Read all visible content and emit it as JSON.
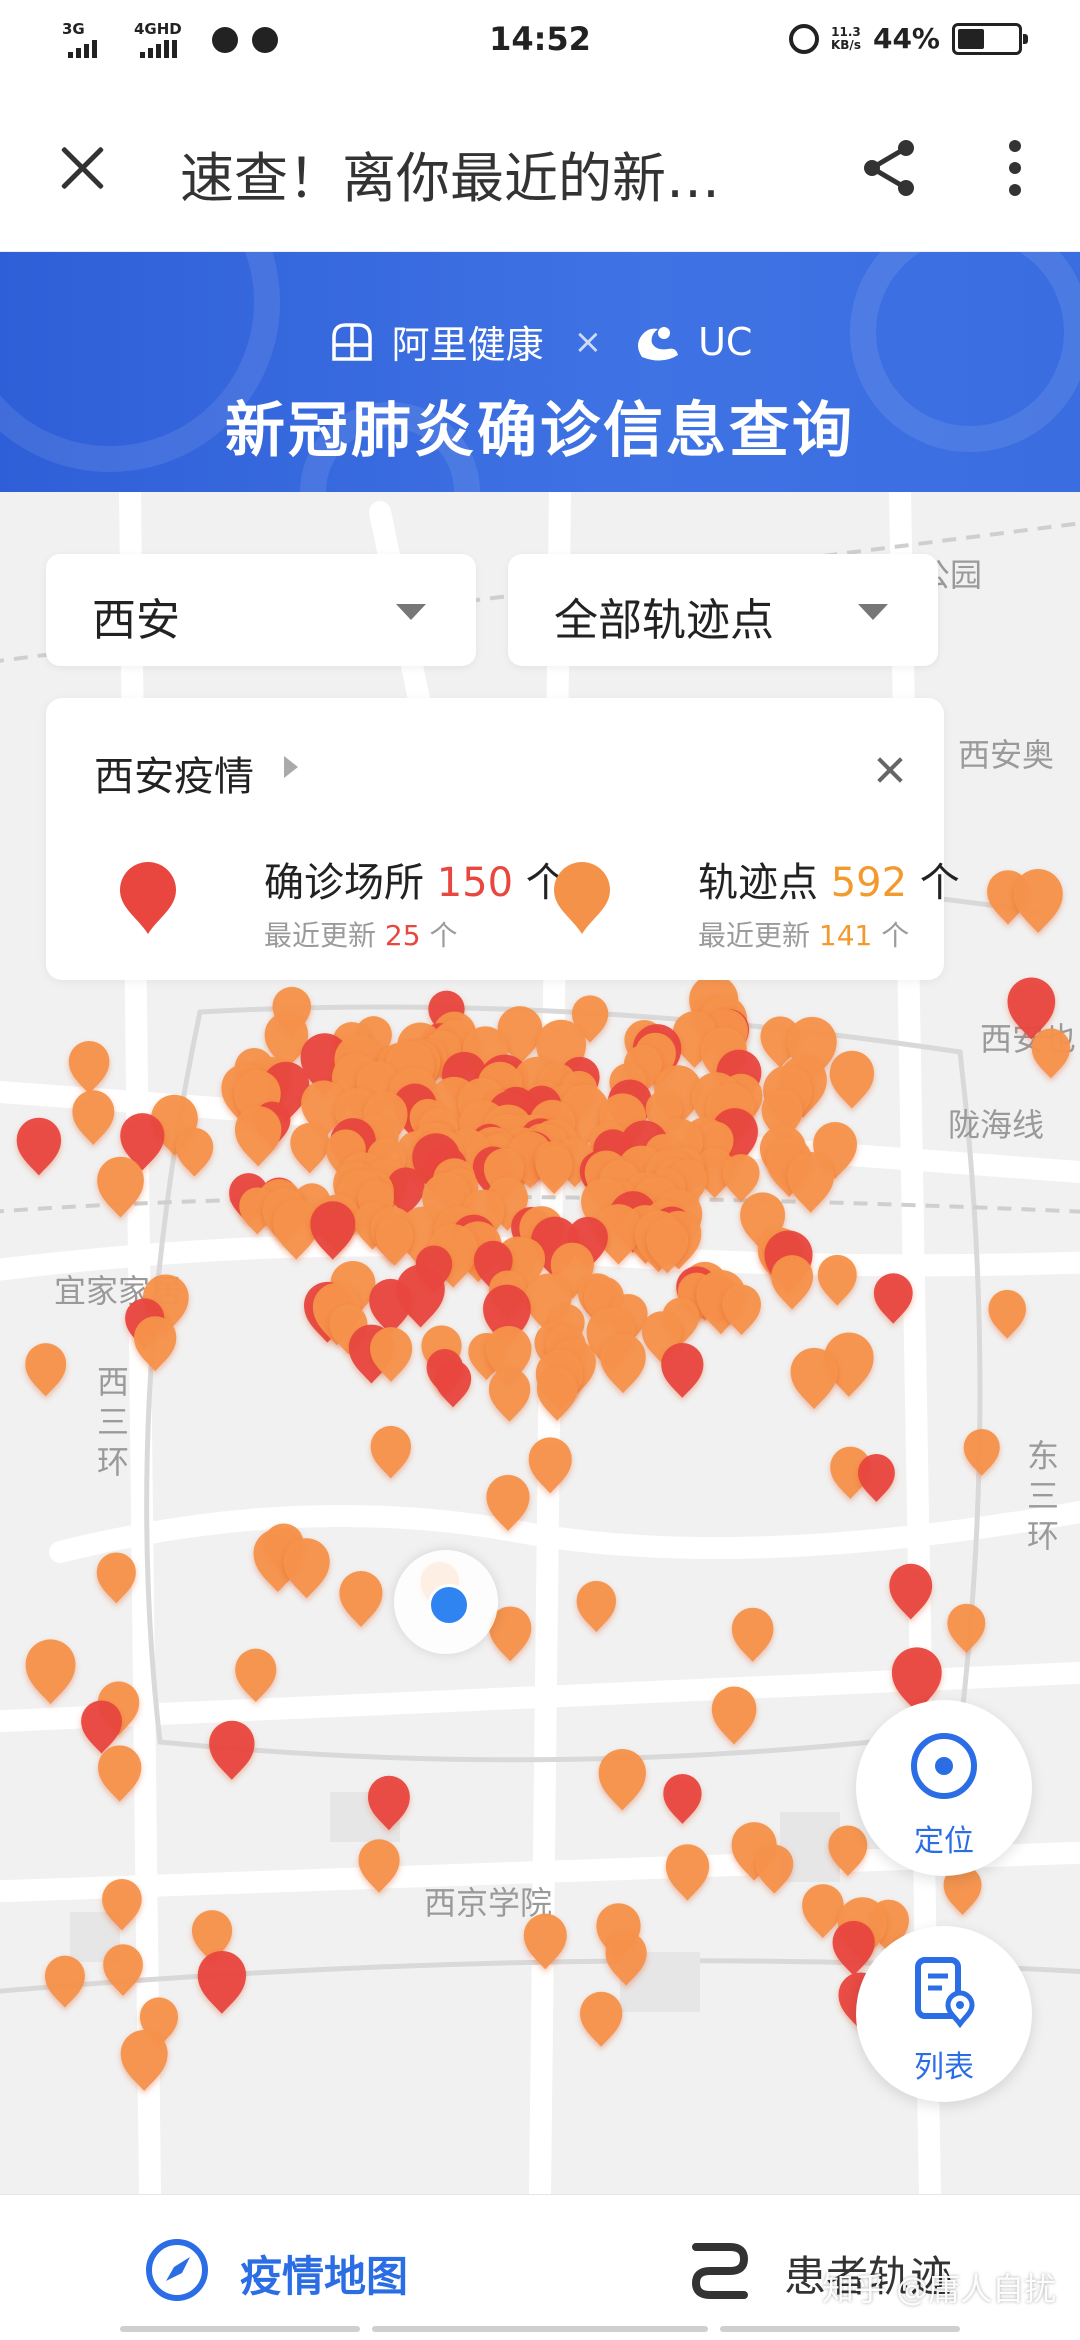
{
  "status_bar": {
    "signal1": "3G",
    "signal2": "4GHD",
    "time": "14:52",
    "net_speed_value": "11.3",
    "net_speed_unit": "KB/s",
    "battery_pct": "44%",
    "battery_level": 0.44
  },
  "titlebar": {
    "title": "速查！离你最近的新…"
  },
  "banner": {
    "brand1": "阿里健康",
    "times": "×",
    "brand2": "UC",
    "title": "新冠肺炎确诊信息查询",
    "color": "#3366dd"
  },
  "filters": {
    "city": "西安",
    "type": "全部轨迹点"
  },
  "info_card": {
    "city_label": "西安疫情",
    "confirmed": {
      "label": "确诊场所",
      "count": "150",
      "unit": "个",
      "recent_label": "最近更新",
      "recent_count": "25",
      "recent_unit": "个",
      "color": "#e8463e"
    },
    "track": {
      "label": "轨迹点",
      "count": "592",
      "unit": "个",
      "recent_label": "最近更新",
      "recent_count": "141",
      "recent_unit": "个",
      "color": "#f29a2e"
    }
  },
  "map": {
    "labels": {
      "park": "公园",
      "xian_ao": "西安奥",
      "xian_north": "西安也",
      "longhai": "陇海线",
      "yijia": "宜家家居",
      "west_ring": "西三环",
      "east_ring": "东三环",
      "xijing": "西京学院"
    }
  },
  "fab": {
    "locate": "定位",
    "list": "列表"
  },
  "bottom_nav": {
    "tab1": "疫情地图",
    "tab2": "患者轨迹"
  },
  "watermark": "知乎 @庸人自扰",
  "colors": {
    "accent": "#2b6de5",
    "confirmed_pin": "#e8463e",
    "track_pin": "#f5924a"
  }
}
